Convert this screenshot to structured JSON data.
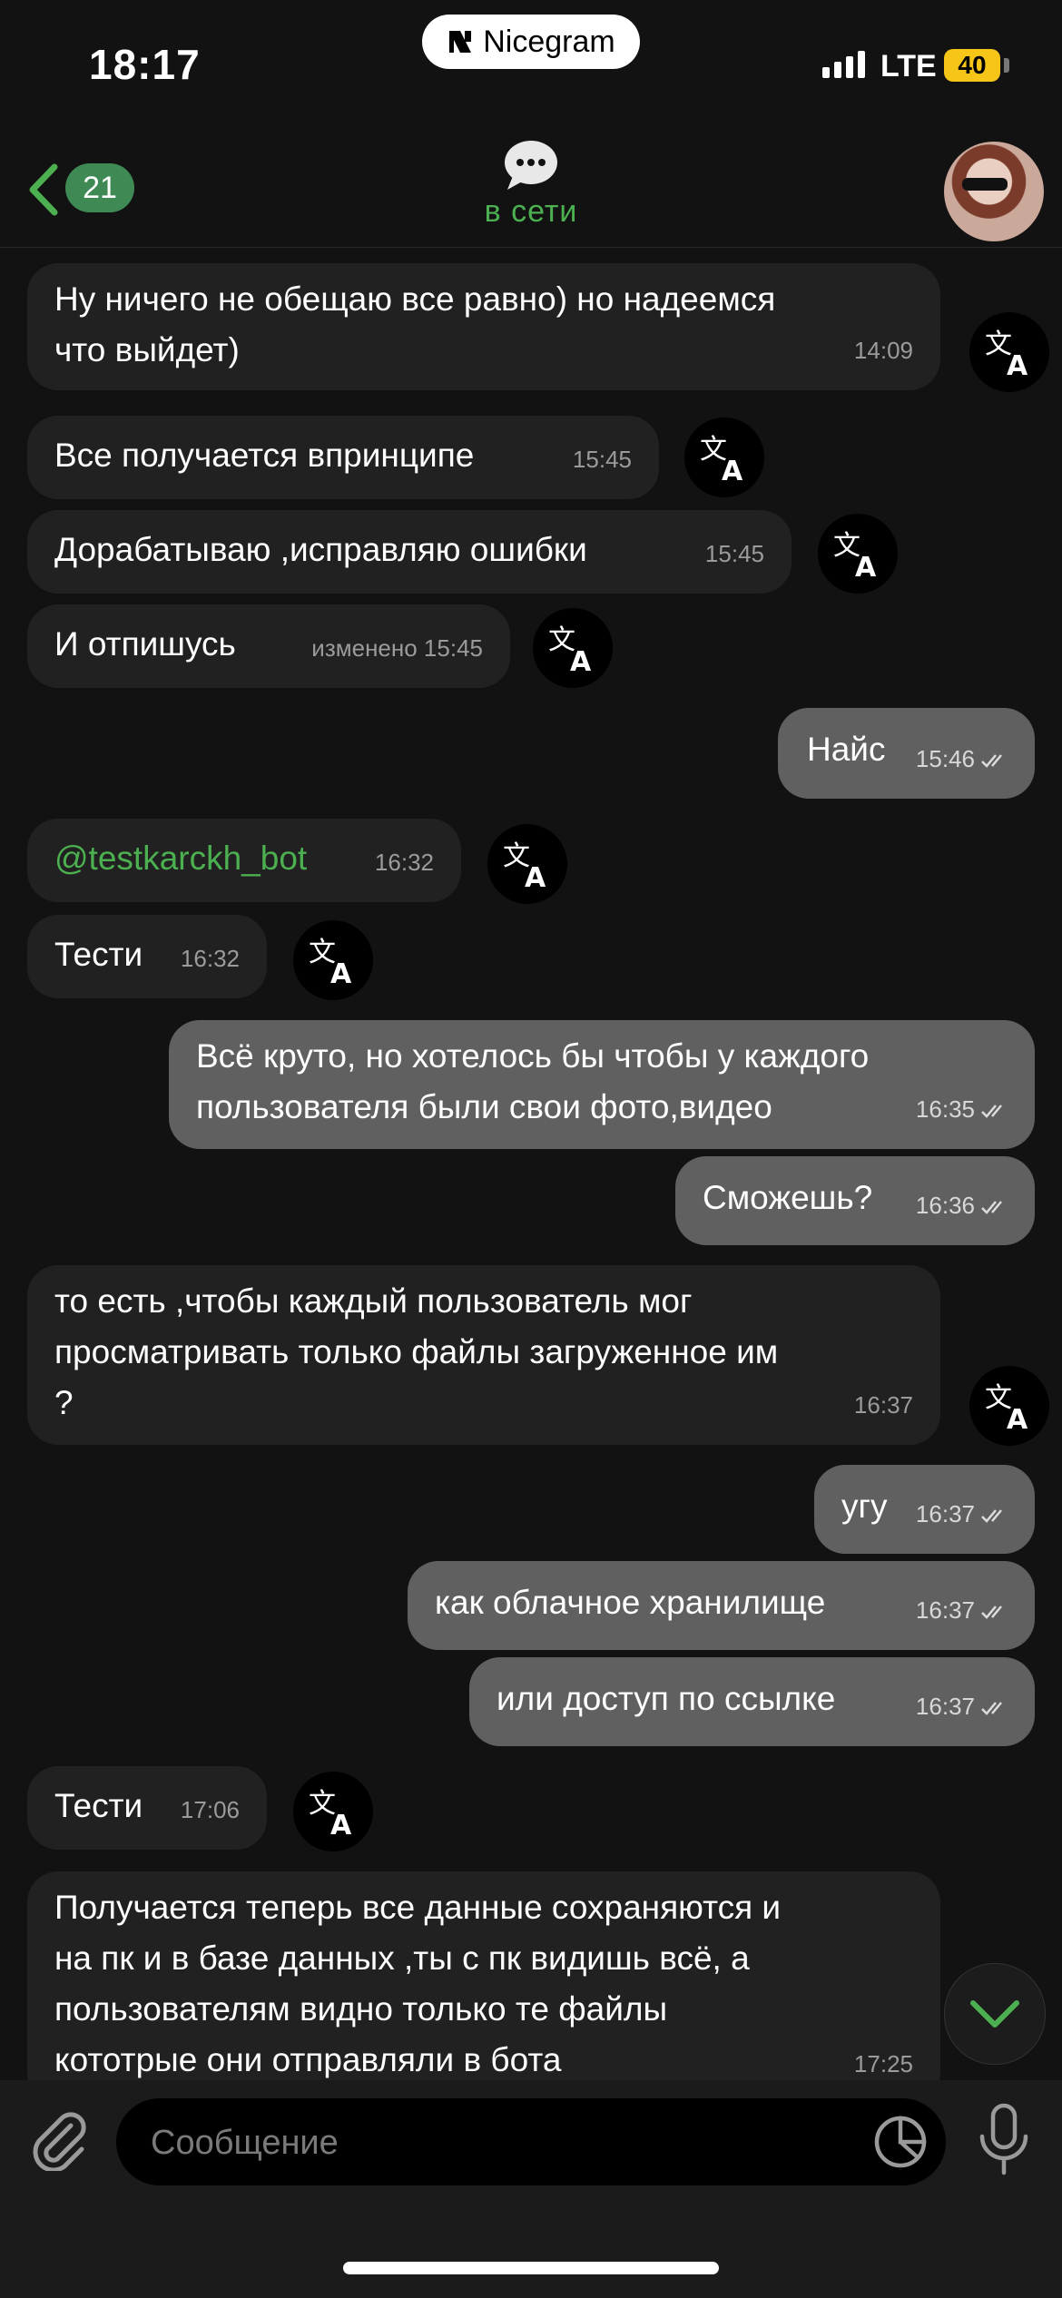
{
  "status_bar": {
    "time": "18:17",
    "island_app": "Nicegram",
    "network": "LTE",
    "battery": "40"
  },
  "header": {
    "unread_count": "21",
    "status": "в сети"
  },
  "messages": [
    {
      "text": "Ну ничего не обещаю все равно) но надеемся\nчто выйдет)",
      "time": "14:09",
      "dir": "in"
    },
    {
      "text": "Все получается впринципе",
      "time": "15:45",
      "dir": "in"
    },
    {
      "text": "Дорабатываю ,исправляю ошибки",
      "time": "15:45",
      "dir": "in"
    },
    {
      "text": "И отпишусь",
      "time": "изменено 15:45",
      "dir": "in"
    },
    {
      "text": "Найс",
      "time": "15:46",
      "dir": "out"
    },
    {
      "text": "@testkarckh_bot",
      "time": "16:32",
      "dir": "in"
    },
    {
      "text": "Тести",
      "time": "16:32",
      "dir": "in"
    },
    {
      "text": "Всё круто, но хотелось бы чтобы у каждого\nпользователя были свои фото,видео",
      "time": "16:35",
      "dir": "out"
    },
    {
      "text": "Сможешь?",
      "time": "16:36",
      "dir": "out"
    },
    {
      "text": "то есть ,чтобы каждый пользователь мог\nпросматривать только файлы загруженное им\n?",
      "time": "16:37",
      "dir": "in"
    },
    {
      "text": "угу",
      "time": "16:37",
      "dir": "out"
    },
    {
      "text": "как облачное хранилище",
      "time": "16:37",
      "dir": "out"
    },
    {
      "text": "или доступ по ссылке",
      "time": "16:37",
      "dir": "out"
    },
    {
      "text": "Тести",
      "time": "17:06",
      "dir": "in"
    },
    {
      "text": "Получается теперь все данные сохраняются и\nна пк и в базе данных ,ты с пк видишь всё, а\nпользователям видно только те файлы\nкототрые они отправляли в бота",
      "time": "17:25",
      "dir": "in"
    }
  ],
  "composer": {
    "placeholder": "Сообщение"
  },
  "colors": {
    "accent": "#4caf50",
    "incoming": "#212121",
    "outgoing": "#606060",
    "background": "#121212"
  }
}
